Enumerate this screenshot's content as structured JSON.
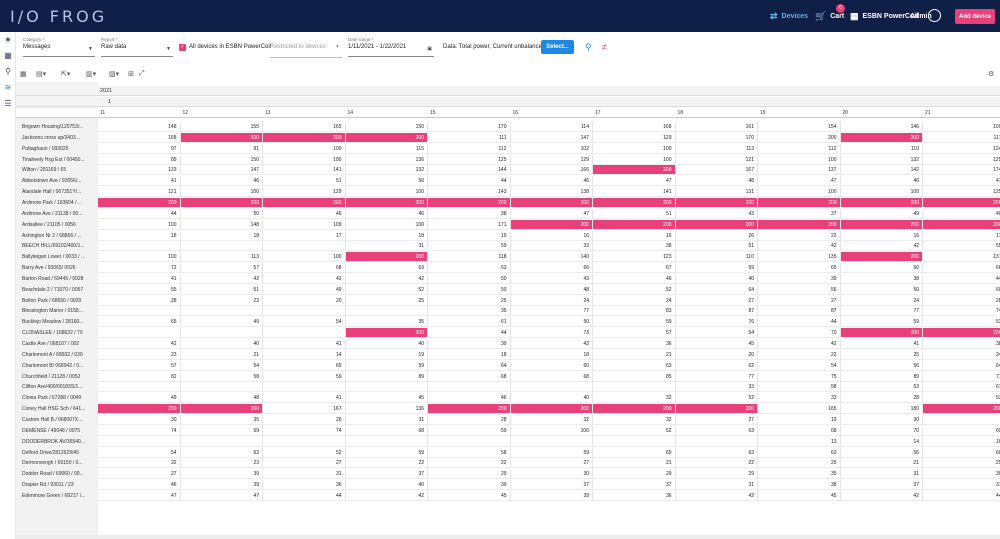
{
  "header": {
    "logo": "I/O  FROG",
    "nav_devices": "Devices",
    "nav_cart": "Cart",
    "cart_count": "0",
    "org": "ESBN PowerCoil",
    "user": "Admin",
    "add_device": "Add device"
  },
  "filters": {
    "category_label": "Category *",
    "category_value": "Messages",
    "report_label": "Report *",
    "report_value": "Raw data",
    "all_devices_label": "All devices in ESBN PowerCoil",
    "restrict_placeholder": "Restricted to devices",
    "date_label": "Date range *",
    "date_value": "1/11/2021 - 1/22/2021",
    "data_text": "Data: Total power, Current unbalance",
    "select_button": "Select..."
  },
  "grid": {
    "year": "2021",
    "month": "1",
    "columns": [
      "11",
      "12",
      "13",
      "14",
      "15",
      "16",
      "17",
      "18",
      "19",
      "20",
      "21"
    ],
    "rows": [
      [
        "Brigown Housing/125753/...",
        [
          148,
          155,
          165,
          150,
          170,
          114,
          168,
          161,
          154,
          146,
          109
        ],
        []
      ],
      [
        "Jacksons cross up/3403...",
        [
          168,
          200,
          200,
          200,
          111,
          147,
          129,
          170,
          200,
          200,
          117
        ],
        [
          1,
          2,
          3,
          9
        ]
      ],
      [
        "Puttaghaun / 093025",
        [
          97,
          91,
          100,
          115,
          112,
          102,
          100,
          113,
          112,
          110,
          124
        ],
        []
      ],
      [
        "Tinaheely Hsg Est / 00450...",
        [
          89,
          150,
          100,
          136,
          125,
          129,
          100,
          121,
          100,
          132,
          125
        ],
        []
      ],
      [
        "Wilton / 281169 / 65",
        [
          133,
          147,
          141,
          132,
          144,
          166,
          200,
          167,
          137,
          142,
          174
        ],
        [
          6
        ]
      ],
      [
        "Abbotstown Ave / 93056/...",
        [
          41,
          46,
          51,
          50,
          44,
          46,
          47,
          48,
          47,
          46,
          47
        ],
        []
      ],
      [
        "Alandale Hall / 067351Y/...",
        [
          121,
          100,
          129,
          100,
          143,
          138,
          141,
          131,
          100,
          100,
          125
        ],
        []
      ],
      [
        "Ardmore Park / 193604 / ...",
        [
          200,
          200,
          200,
          200,
          200,
          200,
          200,
          200,
          200,
          200,
          200
        ],
        [
          0,
          1,
          2,
          3,
          4,
          5,
          6,
          7,
          8,
          9,
          10
        ]
      ],
      [
        "Ardmore Ave / 21138 / 00...",
        [
          44,
          50,
          46,
          46,
          38,
          47,
          51,
          43,
          37,
          49,
          40
        ],
        []
      ],
      [
        "Ardsallee / 21105 / 0056",
        [
          100,
          148,
          109,
          100,
          171,
          200,
          200,
          200,
          200,
          200,
          200
        ],
        [
          5,
          6,
          7,
          8,
          9,
          10
        ]
      ],
      [
        "Ashington Nr 2 / 68866 / ...",
        [
          18,
          18,
          17,
          18,
          19,
          16,
          16,
          26,
          22,
          16,
          17
        ],
        []
      ],
      [
        "BEECH HILL/69102/400/1...",
        [
          "",
          "",
          "",
          31,
          59,
          33,
          38,
          51,
          42,
          42,
          55
        ],
        []
      ],
      [
        "Ballyteigan Lower / 0033 / ...",
        [
          100,
          113,
          100,
          200,
          118,
          140,
          123,
          110,
          135,
          200,
          131
        ],
        [
          3,
          9
        ]
      ],
      [
        "Barry Ave / 93065/ 0026",
        [
          72,
          57,
          68,
          63,
          63,
          66,
          67,
          69,
          65,
          60,
          66
        ],
        []
      ],
      [
        "Barton Road / 69445 / 0028",
        [
          41,
          42,
          42,
          42,
          50,
          43,
          46,
          40,
          39,
          38,
          44
        ],
        []
      ],
      [
        "Beachdale 2 / 71070 / 0057",
        [
          55,
          51,
          49,
          52,
          50,
          48,
          52,
          64,
          56,
          50,
          60
        ],
        []
      ],
      [
        "Belton Park / 68650 / 0029",
        [
          28,
          23,
          20,
          25,
          25,
          24,
          24,
          27,
          27,
          24,
          28
        ],
        []
      ],
      [
        "Blessington Manor / 0158...",
        [
          "",
          "",
          "",
          "",
          35,
          77,
          83,
          87,
          87,
          77,
          74
        ],
        []
      ],
      [
        "Bucklejo Meadow / 28160...",
        [
          65,
          49,
          54,
          35,
          61,
          50,
          59,
          76,
          44,
          59,
          53
        ],
        []
      ],
      [
        "CLONASLEE / 168632 / 70",
        [
          "",
          "",
          "",
          200,
          44,
          73,
          57,
          54,
          70,
          200,
          200
        ],
        [
          3,
          9,
          10
        ]
      ],
      [
        "Castle Ave / 068107 / 002",
        [
          42,
          40,
          41,
          40,
          39,
          43,
          36,
          45,
          42,
          41,
          38
        ],
        []
      ],
      [
        "Charlemont A / 68932 / 030",
        [
          23,
          21,
          14,
          19,
          18,
          18,
          21,
          20,
          22,
          25,
          24
        ],
        []
      ],
      [
        "Charlemont B/ 068942 / 0...",
        [
          57,
          54,
          65,
          59,
          64,
          60,
          63,
          62,
          54,
          56,
          64
        ],
        []
      ],
      [
        "Churchfield / 21128 / 0052",
        [
          82,
          58,
          59,
          89,
          68,
          68,
          85,
          77,
          75,
          89,
          71
        ],
        []
      ],
      [
        "Clifton Ave/400/00183S/1...",
        [
          "",
          "",
          "",
          "",
          "",
          "",
          "",
          33,
          58,
          53,
          67
        ],
        []
      ],
      [
        "Clonia Park / 67288 / 0049",
        [
          49,
          48,
          41,
          45,
          46,
          40,
          32,
          52,
          33,
          28,
          53
        ],
        []
      ],
      [
        "Coney Hall HSG Sch / 641...",
        [
          200,
          200,
          167,
          136,
          200,
          200,
          200,
          200,
          165,
          180,
          200
        ],
        [
          0,
          1,
          4,
          5,
          6,
          7,
          10
        ]
      ],
      [
        "Custom Hall B / 068007X...",
        [
          30,
          35,
          26,
          31,
          28,
          32,
          32,
          27,
          19,
          30,
          ""
        ],
        []
      ],
      [
        "DEMENSE / 49048 / 0075",
        [
          74,
          69,
          74,
          68,
          59,
          106,
          52,
          63,
          68,
          70,
          69
        ],
        []
      ],
      [
        "DOODERBROK AV/36540...",
        [
          "",
          "",
          "",
          "",
          "",
          "",
          "",
          "",
          13,
          14,
          16
        ],
        []
      ],
      [
        "Delford Drive/2812629/45",
        [
          54,
          63,
          52,
          59,
          58,
          59,
          65,
          63,
          62,
          56,
          60
        ],
        []
      ],
      [
        "Dermonvengh / 69150 / 0...",
        [
          22,
          23,
          27,
          22,
          22,
          27,
          21,
          22,
          25,
          21,
          25
        ],
        []
      ],
      [
        "Dodder Road / 69060 / 00...",
        [
          27,
          39,
          31,
          37,
          29,
          30,
          29,
          29,
          35,
          31,
          30
        ],
        []
      ],
      [
        "Drapier Rd / 93011 / 23",
        [
          46,
          39,
          36,
          40,
          39,
          37,
          37,
          31,
          38,
          37,
          37
        ],
        []
      ],
      [
        "Edenmore Green / 68217 /...",
        [
          47,
          47,
          44,
          42,
          45,
          39,
          36,
          42,
          45,
          42,
          44
        ],
        []
      ]
    ]
  }
}
